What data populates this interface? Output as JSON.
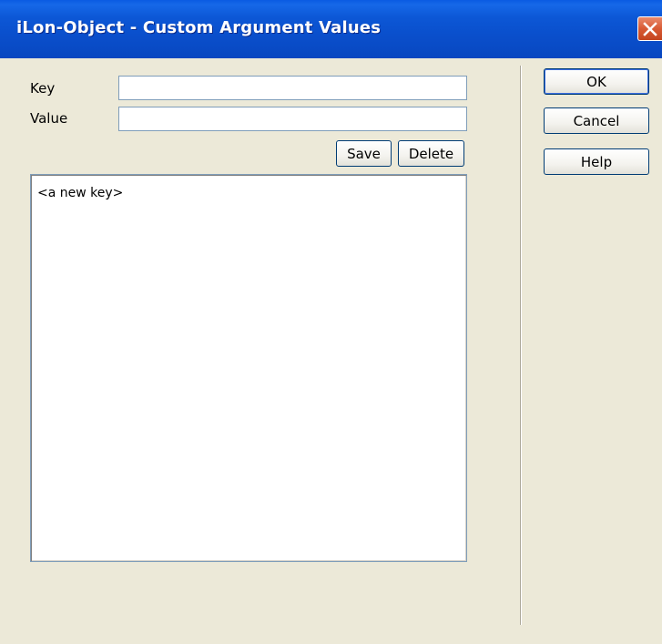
{
  "window": {
    "title": "iLon-Object - Custom Argument Values",
    "accent_color": "#0a4fcc"
  },
  "form": {
    "key_label": "Key",
    "key_value": "",
    "value_label": "Value",
    "value_value": ""
  },
  "actions": {
    "save_label": "Save",
    "delete_label": "Delete"
  },
  "list": {
    "items": [
      "<a new key>"
    ]
  },
  "dialog_buttons": {
    "ok_label": "OK",
    "cancel_label": "Cancel",
    "help_label": "Help"
  }
}
